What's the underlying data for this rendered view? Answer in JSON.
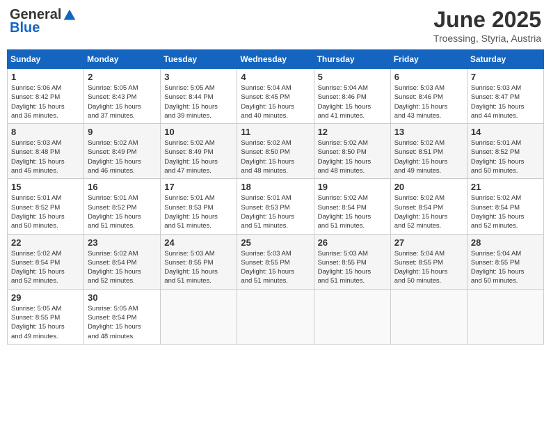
{
  "logo": {
    "general": "General",
    "blue": "Blue"
  },
  "header": {
    "title": "June 2025",
    "location": "Troessing, Styria, Austria"
  },
  "weekdays": [
    "Sunday",
    "Monday",
    "Tuesday",
    "Wednesday",
    "Thursday",
    "Friday",
    "Saturday"
  ],
  "weeks": [
    [
      {
        "day": "1",
        "sunrise": "5:06 AM",
        "sunset": "8:42 PM",
        "daylight": "15 hours and 36 minutes."
      },
      {
        "day": "2",
        "sunrise": "5:05 AM",
        "sunset": "8:43 PM",
        "daylight": "15 hours and 37 minutes."
      },
      {
        "day": "3",
        "sunrise": "5:05 AM",
        "sunset": "8:44 PM",
        "daylight": "15 hours and 39 minutes."
      },
      {
        "day": "4",
        "sunrise": "5:04 AM",
        "sunset": "8:45 PM",
        "daylight": "15 hours and 40 minutes."
      },
      {
        "day": "5",
        "sunrise": "5:04 AM",
        "sunset": "8:46 PM",
        "daylight": "15 hours and 41 minutes."
      },
      {
        "day": "6",
        "sunrise": "5:03 AM",
        "sunset": "8:46 PM",
        "daylight": "15 hours and 43 minutes."
      },
      {
        "day": "7",
        "sunrise": "5:03 AM",
        "sunset": "8:47 PM",
        "daylight": "15 hours and 44 minutes."
      }
    ],
    [
      {
        "day": "8",
        "sunrise": "5:03 AM",
        "sunset": "8:48 PM",
        "daylight": "15 hours and 45 minutes."
      },
      {
        "day": "9",
        "sunrise": "5:02 AM",
        "sunset": "8:49 PM",
        "daylight": "15 hours and 46 minutes."
      },
      {
        "day": "10",
        "sunrise": "5:02 AM",
        "sunset": "8:49 PM",
        "daylight": "15 hours and 47 minutes."
      },
      {
        "day": "11",
        "sunrise": "5:02 AM",
        "sunset": "8:50 PM",
        "daylight": "15 hours and 48 minutes."
      },
      {
        "day": "12",
        "sunrise": "5:02 AM",
        "sunset": "8:50 PM",
        "daylight": "15 hours and 48 minutes."
      },
      {
        "day": "13",
        "sunrise": "5:02 AM",
        "sunset": "8:51 PM",
        "daylight": "15 hours and 49 minutes."
      },
      {
        "day": "14",
        "sunrise": "5:01 AM",
        "sunset": "8:52 PM",
        "daylight": "15 hours and 50 minutes."
      }
    ],
    [
      {
        "day": "15",
        "sunrise": "5:01 AM",
        "sunset": "8:52 PM",
        "daylight": "15 hours and 50 minutes."
      },
      {
        "day": "16",
        "sunrise": "5:01 AM",
        "sunset": "8:52 PM",
        "daylight": "15 hours and 51 minutes."
      },
      {
        "day": "17",
        "sunrise": "5:01 AM",
        "sunset": "8:53 PM",
        "daylight": "15 hours and 51 minutes."
      },
      {
        "day": "18",
        "sunrise": "5:01 AM",
        "sunset": "8:53 PM",
        "daylight": "15 hours and 51 minutes."
      },
      {
        "day": "19",
        "sunrise": "5:02 AM",
        "sunset": "8:54 PM",
        "daylight": "15 hours and 51 minutes."
      },
      {
        "day": "20",
        "sunrise": "5:02 AM",
        "sunset": "8:54 PM",
        "daylight": "15 hours and 52 minutes."
      },
      {
        "day": "21",
        "sunrise": "5:02 AM",
        "sunset": "8:54 PM",
        "daylight": "15 hours and 52 minutes."
      }
    ],
    [
      {
        "day": "22",
        "sunrise": "5:02 AM",
        "sunset": "8:54 PM",
        "daylight": "15 hours and 52 minutes."
      },
      {
        "day": "23",
        "sunrise": "5:02 AM",
        "sunset": "8:54 PM",
        "daylight": "15 hours and 52 minutes."
      },
      {
        "day": "24",
        "sunrise": "5:03 AM",
        "sunset": "8:55 PM",
        "daylight": "15 hours and 51 minutes."
      },
      {
        "day": "25",
        "sunrise": "5:03 AM",
        "sunset": "8:55 PM",
        "daylight": "15 hours and 51 minutes."
      },
      {
        "day": "26",
        "sunrise": "5:03 AM",
        "sunset": "8:55 PM",
        "daylight": "15 hours and 51 minutes."
      },
      {
        "day": "27",
        "sunrise": "5:04 AM",
        "sunset": "8:55 PM",
        "daylight": "15 hours and 50 minutes."
      },
      {
        "day": "28",
        "sunrise": "5:04 AM",
        "sunset": "8:55 PM",
        "daylight": "15 hours and 50 minutes."
      }
    ],
    [
      {
        "day": "29",
        "sunrise": "5:05 AM",
        "sunset": "8:55 PM",
        "daylight": "15 hours and 49 minutes."
      },
      {
        "day": "30",
        "sunrise": "5:05 AM",
        "sunset": "8:54 PM",
        "daylight": "15 hours and 48 minutes."
      },
      null,
      null,
      null,
      null,
      null
    ]
  ]
}
